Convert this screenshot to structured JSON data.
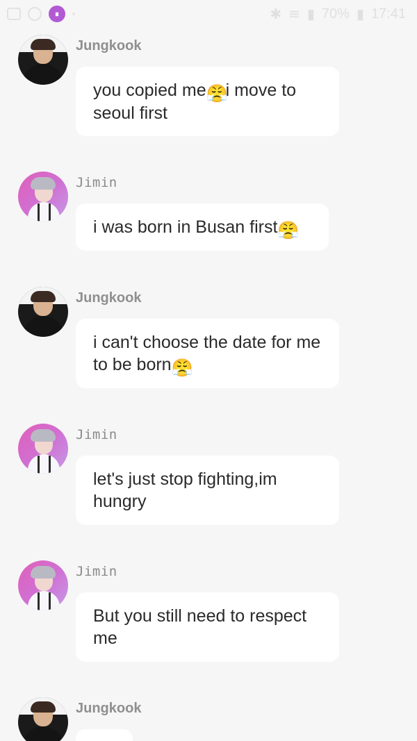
{
  "status_bar": {
    "time": "17:41",
    "battery": "70%",
    "left_icons": [
      "gallery-icon",
      "sync-icon",
      "bts-app-icon",
      "notification-dot-icon"
    ],
    "right_icons": [
      "bluetooth-icon",
      "wifi-icon",
      "signal-icon",
      "battery-icon"
    ]
  },
  "messages": [
    {
      "sender": "Jungkook",
      "text": "you copied me",
      "emoji": "😤",
      "text_after": "i move to seoul first"
    },
    {
      "sender": "Jimin",
      "text": "i was born in Busan first",
      "emoji": "😤",
      "text_after": ""
    },
    {
      "sender": "Jungkook",
      "text": "i can't choose the date for me to be born",
      "emoji": "😤",
      "text_after": ""
    },
    {
      "sender": "Jimin",
      "text": "let's just stop fighting,im hungry",
      "emoji": "",
      "text_after": ""
    },
    {
      "sender": "Jimin",
      "text": "But you still need to respect me",
      "emoji": "",
      "text_after": ""
    },
    {
      "sender": "Jungkook",
      "text": "",
      "emoji": "",
      "text_after": ""
    }
  ]
}
